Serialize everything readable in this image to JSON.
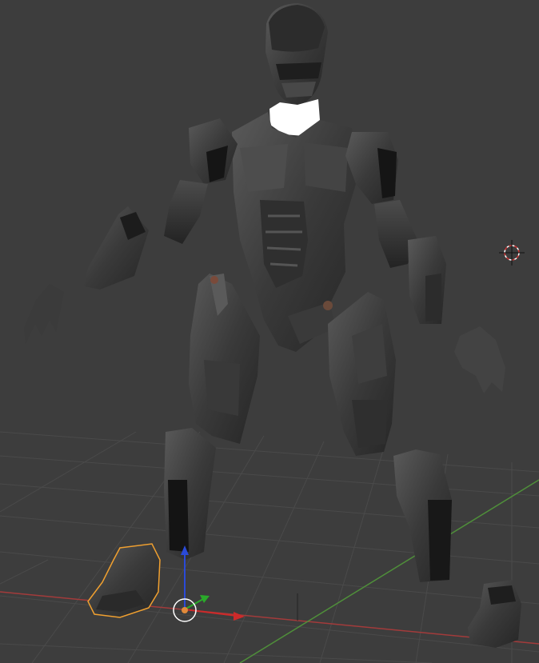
{
  "viewport": {
    "background": "#3d3d3d",
    "grid_color": "#4a4a4a",
    "x_axis_color": "#a33b3b",
    "y_axis_color": "#4f8f3a",
    "selection_outline_color": "#f0a030"
  },
  "scene": {
    "parts": [
      {
        "name": "helmet",
        "selected": false
      },
      {
        "name": "neck-collar",
        "selected": false
      },
      {
        "name": "torso-armor",
        "selected": false
      },
      {
        "name": "left-shoulder-arm",
        "selected": false
      },
      {
        "name": "right-shoulder-arm",
        "selected": false
      },
      {
        "name": "left-forearm",
        "selected": false
      },
      {
        "name": "right-forearm",
        "selected": false
      },
      {
        "name": "left-hand",
        "selected": false
      },
      {
        "name": "right-hand",
        "selected": false
      },
      {
        "name": "left-thigh",
        "selected": false
      },
      {
        "name": "right-thigh",
        "selected": false
      },
      {
        "name": "left-shin",
        "selected": false
      },
      {
        "name": "right-shin",
        "selected": false
      },
      {
        "name": "left-foot",
        "selected": true
      },
      {
        "name": "right-foot",
        "selected": false
      }
    ],
    "icons": [
      "3d-cursor-icon",
      "transform-gizmo-icon",
      "origin-point-icon"
    ]
  }
}
